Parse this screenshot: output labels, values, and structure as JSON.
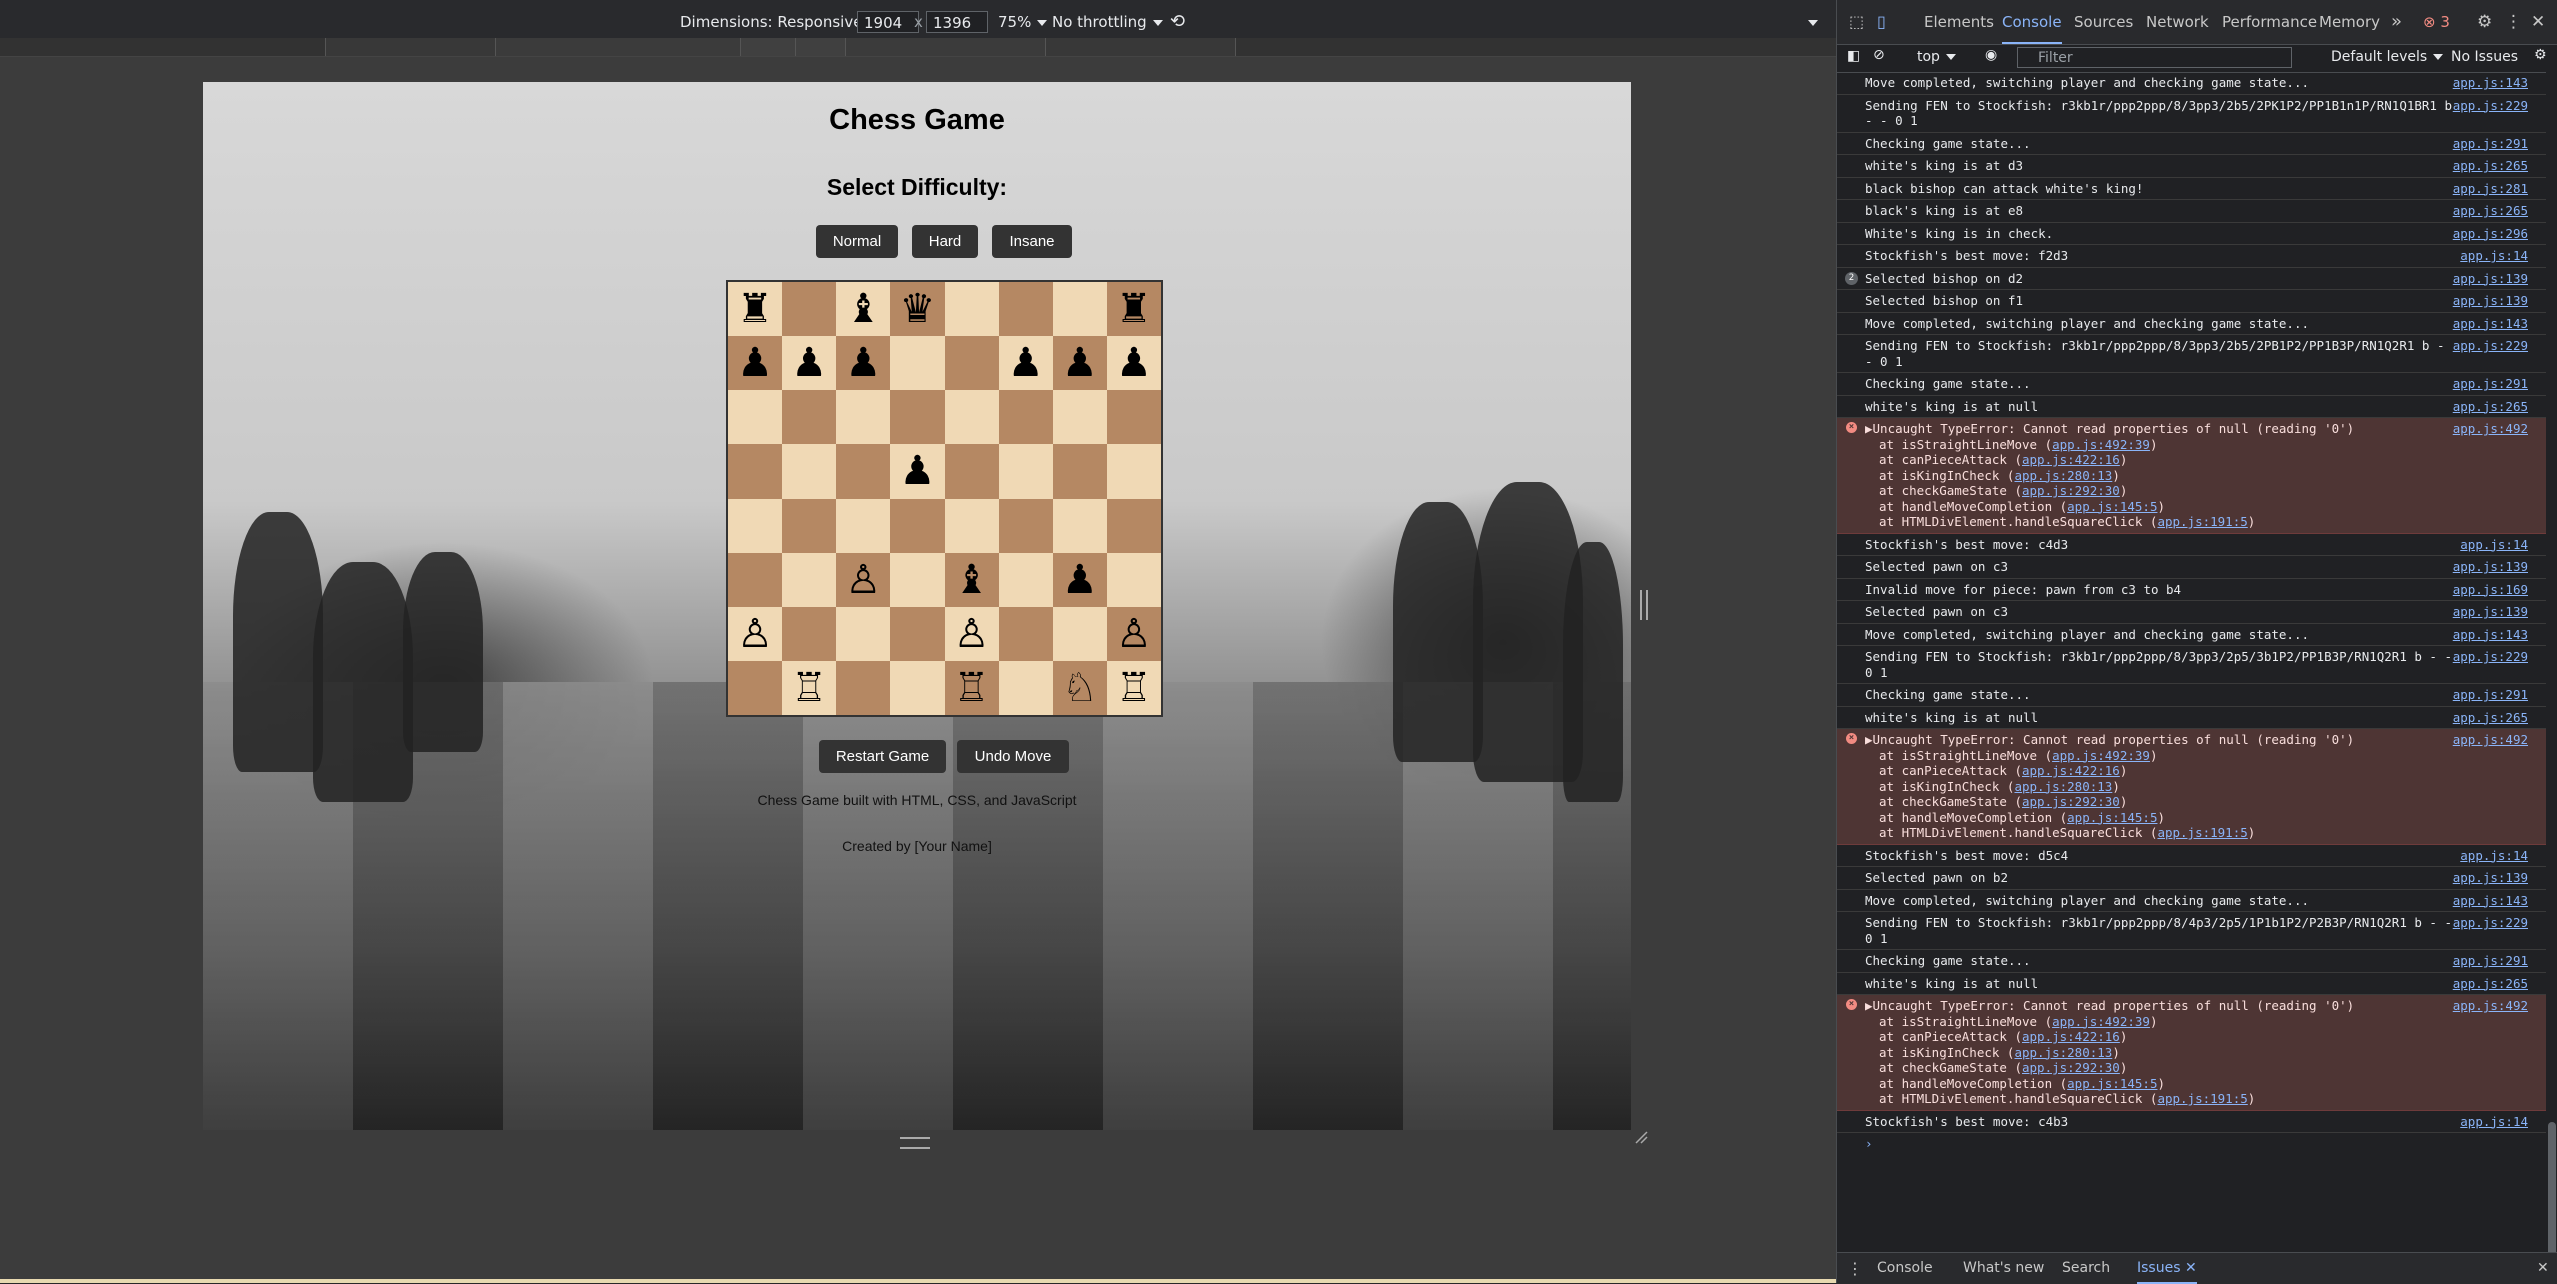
{
  "device_toolbar": {
    "dimensions_label": "Dimensions: Responsive",
    "width": "1904",
    "times": "x",
    "height": "1396",
    "zoom": "75%",
    "throttling": "No throttling"
  },
  "page": {
    "title": "Chess Game",
    "difficulty_label": "Select Difficulty:",
    "difficulty_buttons": [
      "Normal",
      "Hard",
      "Insane"
    ],
    "restart_label": "Restart Game",
    "undo_label": "Undo Move",
    "footer_line1": "Chess Game built with HTML, CSS, and JavaScript",
    "footer_line2": "Created by [Your Name]",
    "board": [
      [
        "♜",
        "",
        "♝",
        "♛",
        "",
        "",
        "",
        "♜"
      ],
      [
        "♟",
        "♟",
        "♟",
        "",
        "",
        "♟",
        "♟",
        "♟"
      ],
      [
        "",
        "",
        "",
        "",
        "",
        "",
        "",
        ""
      ],
      [
        "",
        "",
        "",
        "♟",
        "",
        "",
        "",
        ""
      ],
      [
        "",
        "",
        "",
        "",
        "",
        "",
        "",
        ""
      ],
      [
        "",
        "",
        "♙",
        "",
        "♝",
        "",
        "♟",
        ""
      ],
      [
        "♙",
        "",
        "",
        "",
        "♙",
        "",
        "",
        "♙"
      ],
      [
        "",
        "♖",
        "",
        "",
        "♖",
        "",
        "♘",
        "♖"
      ]
    ]
  },
  "devtools": {
    "tabs": [
      "Elements",
      "Console",
      "Sources",
      "Network",
      "Performance",
      "Memory"
    ],
    "active_tab": "Console",
    "more_tabs": "»",
    "error_count": "3",
    "context": "top",
    "filter_placeholder": "Filter",
    "levels": "Default levels",
    "issues": "No Issues",
    "log": [
      {
        "type": "info",
        "text": "Move completed, switching player and checking game state...",
        "src": "app.js:143"
      },
      {
        "type": "info",
        "text": "Sending FEN to Stockfish: r3kb1r/ppp2ppp/8/3pp3/2b5/2PK1P2/PP1B1n1P/RN1Q1BR1 b - - 0 1",
        "src": "app.js:229"
      },
      {
        "type": "info",
        "text": "Checking game state...",
        "src": "app.js:291"
      },
      {
        "type": "info",
        "text": "white's king is at d3",
        "src": "app.js:265"
      },
      {
        "type": "info",
        "text": "black bishop can attack white's king!",
        "src": "app.js:281"
      },
      {
        "type": "info",
        "text": "black's king is at e8",
        "src": "app.js:265"
      },
      {
        "type": "info",
        "text": "White's king is in check.",
        "src": "app.js:296"
      },
      {
        "type": "info",
        "text": "Stockfish's best move: f2d3",
        "src": "app.js:14"
      },
      {
        "type": "count",
        "count": "2",
        "text": "Selected bishop on d2",
        "src": "app.js:139"
      },
      {
        "type": "info",
        "text": "Selected bishop on f1",
        "src": "app.js:139"
      },
      {
        "type": "info",
        "text": "Move completed, switching player and checking game state...",
        "src": "app.js:143"
      },
      {
        "type": "info",
        "text": "Sending FEN to Stockfish: r3kb1r/ppp2ppp/8/3pp3/2b5/2PB1P2/PP1B3P/RN1Q2R1 b - - 0 1",
        "src": "app.js:229"
      },
      {
        "type": "info",
        "text": "Checking game state...",
        "src": "app.js:291"
      },
      {
        "type": "info",
        "text": "white's king is at null",
        "src": "app.js:265"
      },
      {
        "type": "error",
        "text": "▶Uncaught TypeError: Cannot read properties of null (reading '0')",
        "src": "app.js:492",
        "stack": [
          {
            "pre": "at isStraightLineMove (",
            "link": "app.js:492:39",
            "post": ")"
          },
          {
            "pre": "at canPieceAttack (",
            "link": "app.js:422:16",
            "post": ")"
          },
          {
            "pre": "at isKingInCheck (",
            "link": "app.js:280:13",
            "post": ")"
          },
          {
            "pre": "at checkGameState (",
            "link": "app.js:292:30",
            "post": ")"
          },
          {
            "pre": "at handleMoveCompletion (",
            "link": "app.js:145:5",
            "post": ")"
          },
          {
            "pre": "at HTMLDivElement.handleSquareClick (",
            "link": "app.js:191:5",
            "post": ")"
          }
        ]
      },
      {
        "type": "info",
        "text": "Stockfish's best move: c4d3",
        "src": "app.js:14"
      },
      {
        "type": "info",
        "text": "Selected pawn on c3",
        "src": "app.js:139"
      },
      {
        "type": "info",
        "text": "Invalid move for piece: pawn from c3 to b4",
        "src": "app.js:169"
      },
      {
        "type": "info",
        "text": "Selected pawn on c3",
        "src": "app.js:139"
      },
      {
        "type": "info",
        "text": "Move completed, switching player and checking game state...",
        "src": "app.js:143"
      },
      {
        "type": "info",
        "text": "Sending FEN to Stockfish: r3kb1r/ppp2ppp/8/3pp3/2p5/3b1P2/PP1B3P/RN1Q2R1 b - - 0 1",
        "src": "app.js:229"
      },
      {
        "type": "info",
        "text": "Checking game state...",
        "src": "app.js:291"
      },
      {
        "type": "info",
        "text": "white's king is at null",
        "src": "app.js:265"
      },
      {
        "type": "error",
        "text": "▶Uncaught TypeError: Cannot read properties of null (reading '0')",
        "src": "app.js:492",
        "stack": [
          {
            "pre": "at isStraightLineMove (",
            "link": "app.js:492:39",
            "post": ")"
          },
          {
            "pre": "at canPieceAttack (",
            "link": "app.js:422:16",
            "post": ")"
          },
          {
            "pre": "at isKingInCheck (",
            "link": "app.js:280:13",
            "post": ")"
          },
          {
            "pre": "at checkGameState (",
            "link": "app.js:292:30",
            "post": ")"
          },
          {
            "pre": "at handleMoveCompletion (",
            "link": "app.js:145:5",
            "post": ")"
          },
          {
            "pre": "at HTMLDivElement.handleSquareClick (",
            "link": "app.js:191:5",
            "post": ")"
          }
        ]
      },
      {
        "type": "info",
        "text": "Stockfish's best move: d5c4",
        "src": "app.js:14"
      },
      {
        "type": "info",
        "text": "Selected pawn on b2",
        "src": "app.js:139"
      },
      {
        "type": "info",
        "text": "Move completed, switching player and checking game state...",
        "src": "app.js:143"
      },
      {
        "type": "info",
        "text": "Sending FEN to Stockfish: r3kb1r/ppp2ppp/8/4p3/2p5/1P1b1P2/P2B3P/RN1Q2R1 b - - 0 1",
        "src": "app.js:229"
      },
      {
        "type": "info",
        "text": "Checking game state...",
        "src": "app.js:291"
      },
      {
        "type": "info",
        "text": "white's king is at null",
        "src": "app.js:265"
      },
      {
        "type": "error",
        "text": "▶Uncaught TypeError: Cannot read properties of null (reading '0')",
        "src": "app.js:492",
        "stack": [
          {
            "pre": "at isStraightLineMove (",
            "link": "app.js:492:39",
            "post": ")"
          },
          {
            "pre": "at canPieceAttack (",
            "link": "app.js:422:16",
            "post": ")"
          },
          {
            "pre": "at isKingInCheck (",
            "link": "app.js:280:13",
            "post": ")"
          },
          {
            "pre": "at checkGameState (",
            "link": "app.js:292:30",
            "post": ")"
          },
          {
            "pre": "at handleMoveCompletion (",
            "link": "app.js:145:5",
            "post": ")"
          },
          {
            "pre": "at HTMLDivElement.handleSquareClick (",
            "link": "app.js:191:5",
            "post": ")"
          }
        ]
      },
      {
        "type": "info",
        "text": "Stockfish's best move: c4b3",
        "src": "app.js:14"
      }
    ],
    "prompt": "›",
    "drawer_tabs": [
      "Console",
      "What's new",
      "Search",
      "Issues"
    ],
    "active_drawer_tab": "Issues"
  }
}
